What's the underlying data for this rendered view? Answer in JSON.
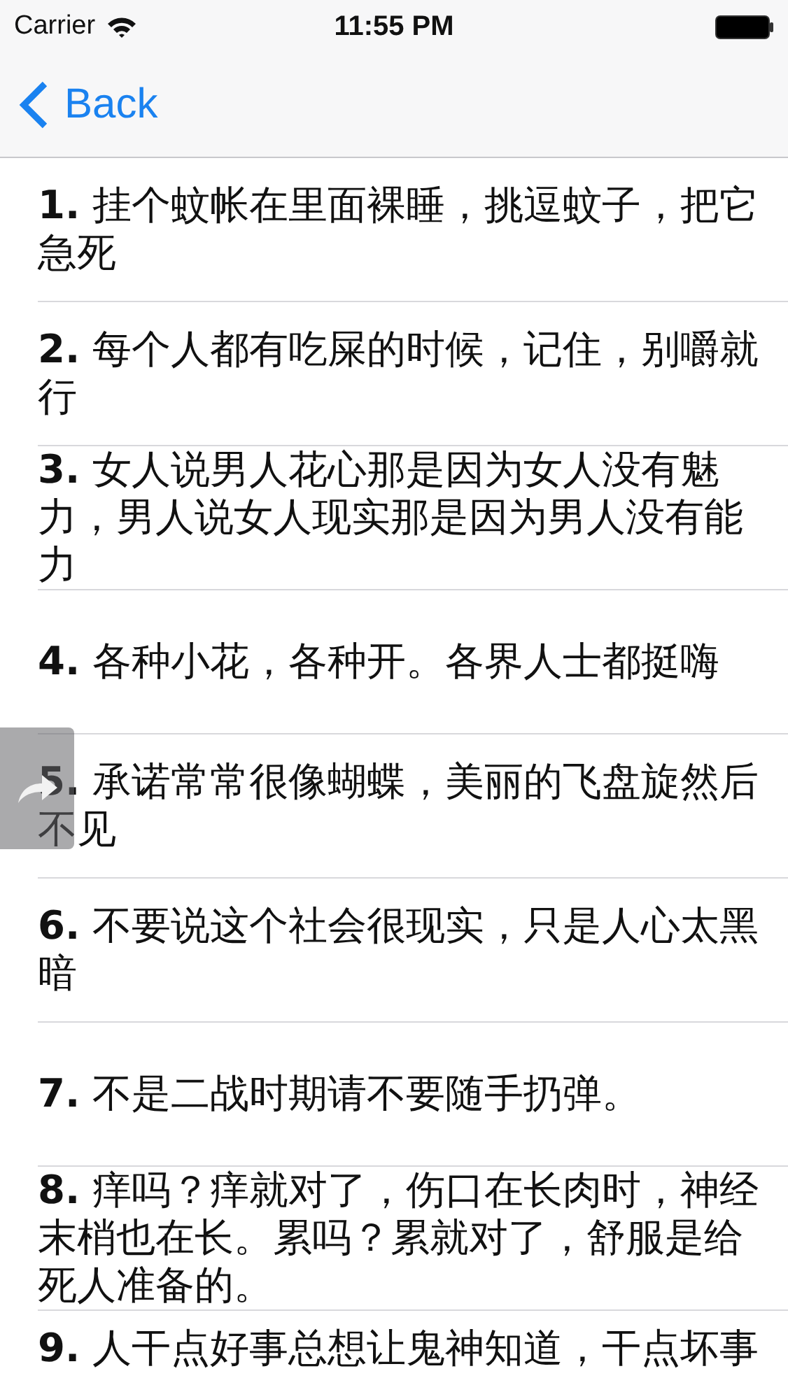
{
  "status_bar": {
    "carrier": "Carrier",
    "time": "11:55 PM"
  },
  "nav": {
    "back": "Back"
  },
  "items": [
    {
      "text": "**1.** 挂个蚊帐在里面裸睡，挑逗蚊子，把它急死"
    },
    {
      "text": "**2.** 每个人都有吃屎的时候，记住，别嚼就行"
    },
    {
      "text": "**3.** 女人说男人花心那是因为女人没有魅力，男人说女人现实那是因为男人没有能力"
    },
    {
      "text": "**4.** 各种小花，各种开。各界人士都挺嗨"
    },
    {
      "text": "**5.** 承诺常常很像蝴蝶，美丽的飞盘旋然后不见"
    },
    {
      "text": "**6.** 不要说这个社会很现实，只是人心太黑暗"
    },
    {
      "text": "**7.** 不是二战时期请不要随手扔弹。"
    },
    {
      "text": "**8.** 痒吗？痒就对了，伤口在长肉时，神经末梢也在长。累吗？累就对了，舒服是给死人准备的。"
    },
    {
      "text": "**9.** 人干点好事总想让鬼神知道，干点坏事"
    }
  ]
}
